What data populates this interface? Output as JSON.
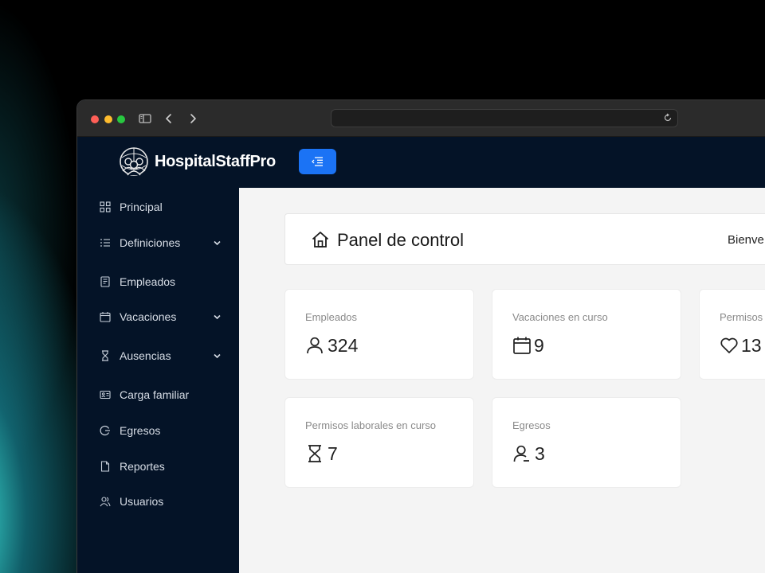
{
  "brand": {
    "name": "HospitalStaffPro"
  },
  "sidebar": {
    "items": [
      {
        "label": "Principal",
        "icon": "grid-icon",
        "expandable": false
      },
      {
        "label": "Definiciones",
        "icon": "list-icon",
        "expandable": true
      },
      {
        "label": "Empleados",
        "icon": "document-icon",
        "expandable": false
      },
      {
        "label": "Vacaciones",
        "icon": "calendar-icon",
        "expandable": true
      },
      {
        "label": "Ausencias",
        "icon": "hourglass-icon",
        "expandable": true
      },
      {
        "label": "Carga familiar",
        "icon": "id-card-icon",
        "expandable": false
      },
      {
        "label": "Egresos",
        "icon": "exit-icon",
        "expandable": false
      },
      {
        "label": "Reportes",
        "icon": "file-icon",
        "expandable": false
      },
      {
        "label": "Usuarios",
        "icon": "users-icon",
        "expandable": false
      }
    ]
  },
  "header": {
    "title": "Panel de control",
    "welcome": "Bienve"
  },
  "stats": [
    {
      "label": "Empleados",
      "value": "324",
      "icon": "user-icon"
    },
    {
      "label": "Vacaciones en curso",
      "value": "9",
      "icon": "calendar-icon"
    },
    {
      "label": "Permisos",
      "value": "13",
      "icon": "heart-icon"
    },
    {
      "label": "Permisos laborales en curso",
      "value": "7",
      "icon": "hourglass-icon"
    },
    {
      "label": "Egresos",
      "value": "3",
      "icon": "user-minus-icon"
    }
  ],
  "colors": {
    "sidebar_bg": "#041327",
    "accent": "#1b73f5",
    "content_bg": "#f4f4f4"
  }
}
